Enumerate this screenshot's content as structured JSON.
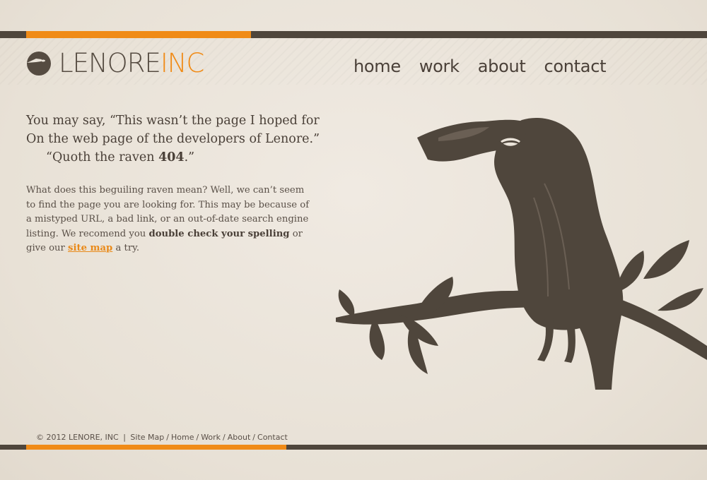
{
  "brand": {
    "name_part1": "LENORE",
    "name_part2": "INC"
  },
  "nav": {
    "items": [
      "home",
      "work",
      "about",
      "contact"
    ]
  },
  "verse": {
    "line1": "You may say, “This wasn’t the page I hoped for",
    "line2": "On the web page of the developers of Lenore.”",
    "line3_prefix": "“Quoth the raven ",
    "line3_bold": "404",
    "line3_suffix": ".”"
  },
  "message": {
    "text1": "What does this beguiling raven mean? Well, we can’t seem to find the page you are looking for. This may be because of a mistyped URL, a bad link, or an out-of-date search engine listing. We recomend you ",
    "bold": "double check your spelling",
    "text2": " or give our ",
    "link": "site map",
    "text3": " a try."
  },
  "footer": {
    "copyright": "© 2012 LENORE, INC",
    "divider": "|",
    "links": [
      "Site Map",
      "Home",
      "Work",
      "About",
      "Contact"
    ],
    "sep": "/"
  },
  "colors": {
    "accent": "#f08b17",
    "dark": "#4f463c",
    "background": "#ebe4da"
  }
}
